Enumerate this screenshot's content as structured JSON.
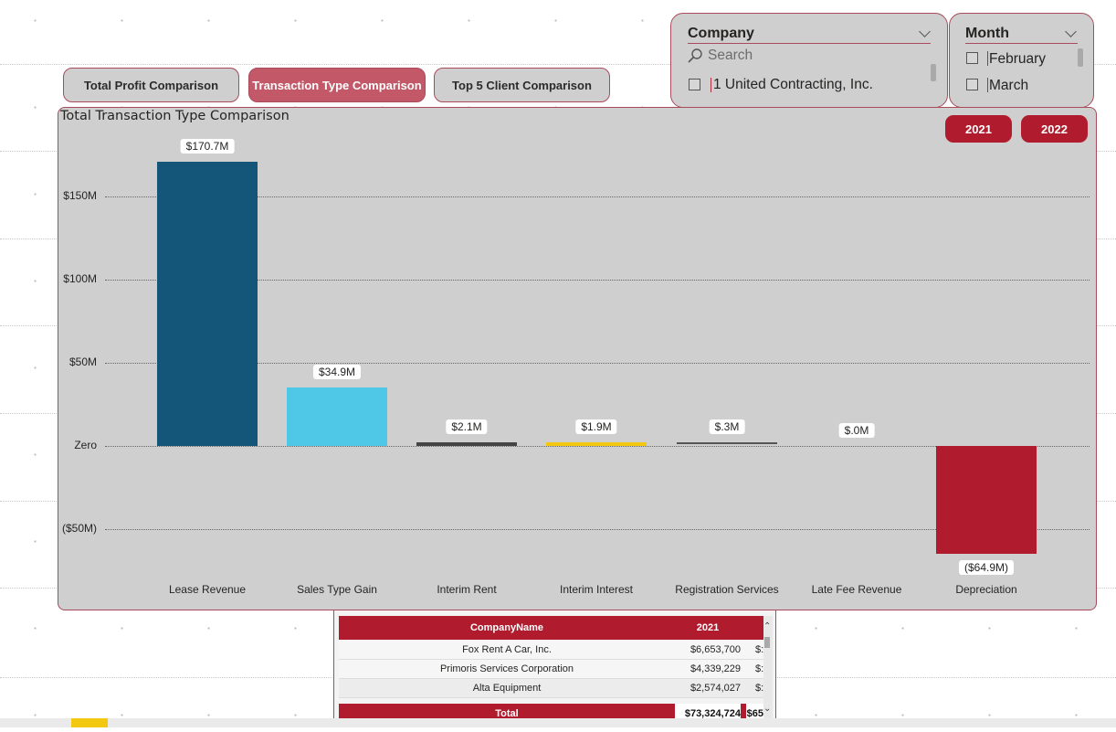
{
  "nav": {
    "buttons": [
      {
        "label": "Total Profit Comparison",
        "active": false
      },
      {
        "label": "Transaction Type Comparison",
        "active": true
      },
      {
        "label": "Top 5 Client Comparison",
        "active": false
      }
    ]
  },
  "company_slicer": {
    "title": "Company",
    "search_placeholder": "Search",
    "options": [
      "1 United Contracting, Inc."
    ]
  },
  "month_slicer": {
    "title": "Month",
    "options": [
      "February",
      "March"
    ]
  },
  "year_buttons": [
    "2021",
    "2022"
  ],
  "colors": {
    "accent": "#b01c2e",
    "panel": "#cfcfcf",
    "border": "#a84b5c",
    "active_button": "#c25868"
  },
  "chart_data": {
    "type": "bar",
    "title": "Total Transaction Type Comparison",
    "categories": [
      "Lease Revenue",
      "Sales Type Gain",
      "Interim Rent",
      "Interim Interest",
      "Registration Services",
      "Late Fee Revenue",
      "Depreciation"
    ],
    "values": [
      170.7,
      34.9,
      2.1,
      1.9,
      0.3,
      0.0,
      -64.9
    ],
    "data_labels": [
      "$170.7M",
      "$34.9M",
      "$2.1M",
      "$1.9M",
      "$.3M",
      "$.0M",
      "($64.9M)"
    ],
    "bar_colors": [
      "#14567a",
      "#4fc8e8",
      "#444444",
      "#f2c811",
      "#555555",
      "#555555",
      "#b01c2e"
    ],
    "yticks": [
      {
        "value": 150,
        "label": "$150M"
      },
      {
        "value": 100,
        "label": "$100M"
      },
      {
        "value": 50,
        "label": "$50M"
      },
      {
        "value": 0,
        "label": "Zero"
      },
      {
        "value": -50,
        "label": "($50M)"
      }
    ],
    "ylim": [
      -75,
      180
    ],
    "grid": true
  },
  "table": {
    "headers": [
      "CompanyName",
      "2021"
    ],
    "rows": [
      {
        "name": "Fox Rent A Car, Inc.",
        "v2021": "$6,653,700",
        "next": "$:"
      },
      {
        "name": "Primoris Services Corporation",
        "v2021": "$4,339,229",
        "next": "$:"
      },
      {
        "name": "Alta Equipment",
        "v2021": "$2,574,027",
        "next": "$:"
      }
    ],
    "total": {
      "label": "Total",
      "v2021": "$73,324,724",
      "next": "$65"
    }
  }
}
